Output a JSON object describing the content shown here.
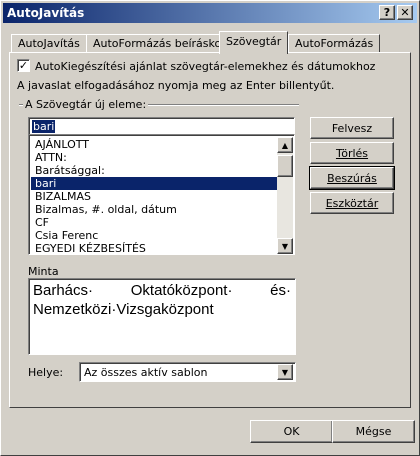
{
  "window": {
    "title": "AutoJavítás",
    "help_label": "?",
    "close_label": "✕"
  },
  "tabs": [
    {
      "label": "AutoJavítás"
    },
    {
      "label": "AutoFormázás beíráskor"
    },
    {
      "label": "Szövegtár"
    },
    {
      "label": "AutoFormázás"
    }
  ],
  "autocomplete": {
    "checked": true,
    "label": "AutoKiegészítési ajánlat szövegtár-elemekhez és dátumokhoz",
    "hint": "A javaslat elfogadásához nyomja meg az Enter billentyűt."
  },
  "entry": {
    "group_label": "A Szövegtár új eleme:",
    "input_value": "bari",
    "list_items": [
      "AJÁNLOTT",
      "ATTN:",
      "Barátsággal:",
      "bari",
      "BIZALMAS",
      "Bizalmas, #. oldal, dátum",
      "CF",
      "Csia Ferenc",
      "EGYEDI KÉZBESÍTÉS"
    ],
    "selected_index": 3
  },
  "buttons": {
    "show": "Felvesz",
    "delete": "Törlés",
    "insert": "Beszúrás",
    "toolbar": "Eszköztár",
    "ok": "OK",
    "cancel": "Mégse"
  },
  "preview": {
    "label": "Minta",
    "line1_a": "Barhács·",
    "line1_b": "Oktatóközpont·",
    "line1_c": "és·",
    "line2": "Nemzetközi·Vizsgaközpont"
  },
  "location": {
    "label": "Helye:",
    "value": "Az összes aktív sablon"
  }
}
